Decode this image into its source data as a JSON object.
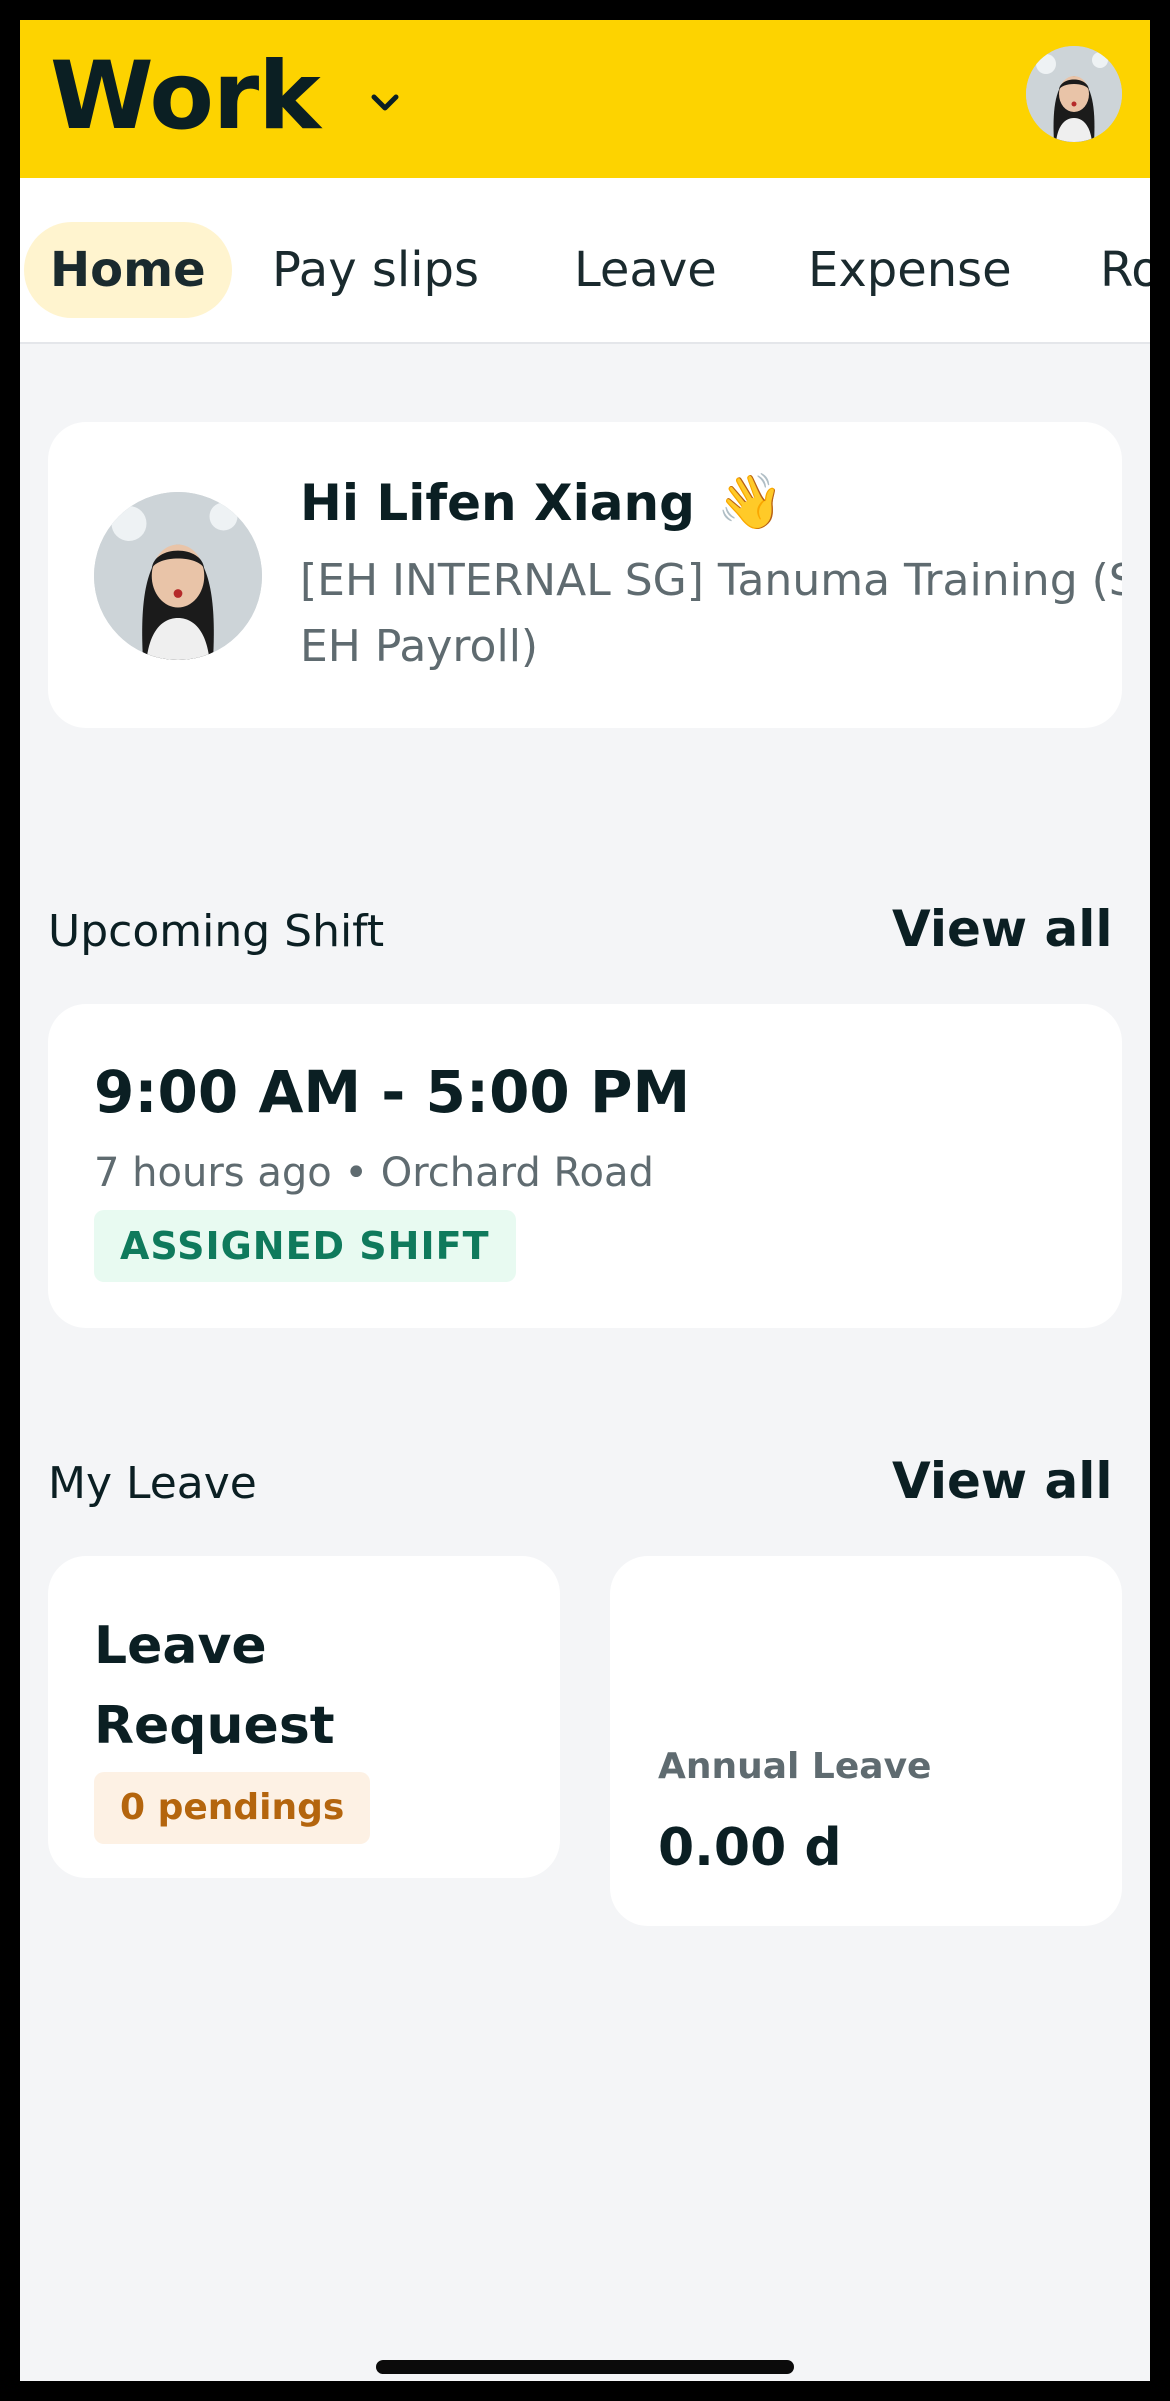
{
  "header": {
    "title": "Work",
    "dropdown_icon": "chevron-down-icon",
    "avatar": "profile-avatar",
    "background_color": "#fdd300"
  },
  "tabs": [
    {
      "label": "Home",
      "active": true
    },
    {
      "label": "Pay slips",
      "active": false
    },
    {
      "label": "Leave",
      "active": false
    },
    {
      "label": "Expense",
      "active": false
    },
    {
      "label": "Ro",
      "active": false
    }
  ],
  "greeting": {
    "title": "Hi Lifen Xiang",
    "emoji": "👋",
    "organisation": "[EH INTERNAL SG] Tanuma Training (SG EH Payroll)"
  },
  "upcoming_shift": {
    "section_title": "Upcoming Shift",
    "view_all": "View all",
    "time": "9:00 AM - 5:00 PM",
    "meta": "7 hours ago • Orchard Road",
    "badge": "ASSIGNED SHIFT"
  },
  "my_leave": {
    "section_title": "My Leave",
    "view_all": "View all",
    "request_title": "Leave Request",
    "pending_badge": "0 pendings",
    "annual_label": "Annual Leave",
    "annual_value": "0.00 d"
  }
}
